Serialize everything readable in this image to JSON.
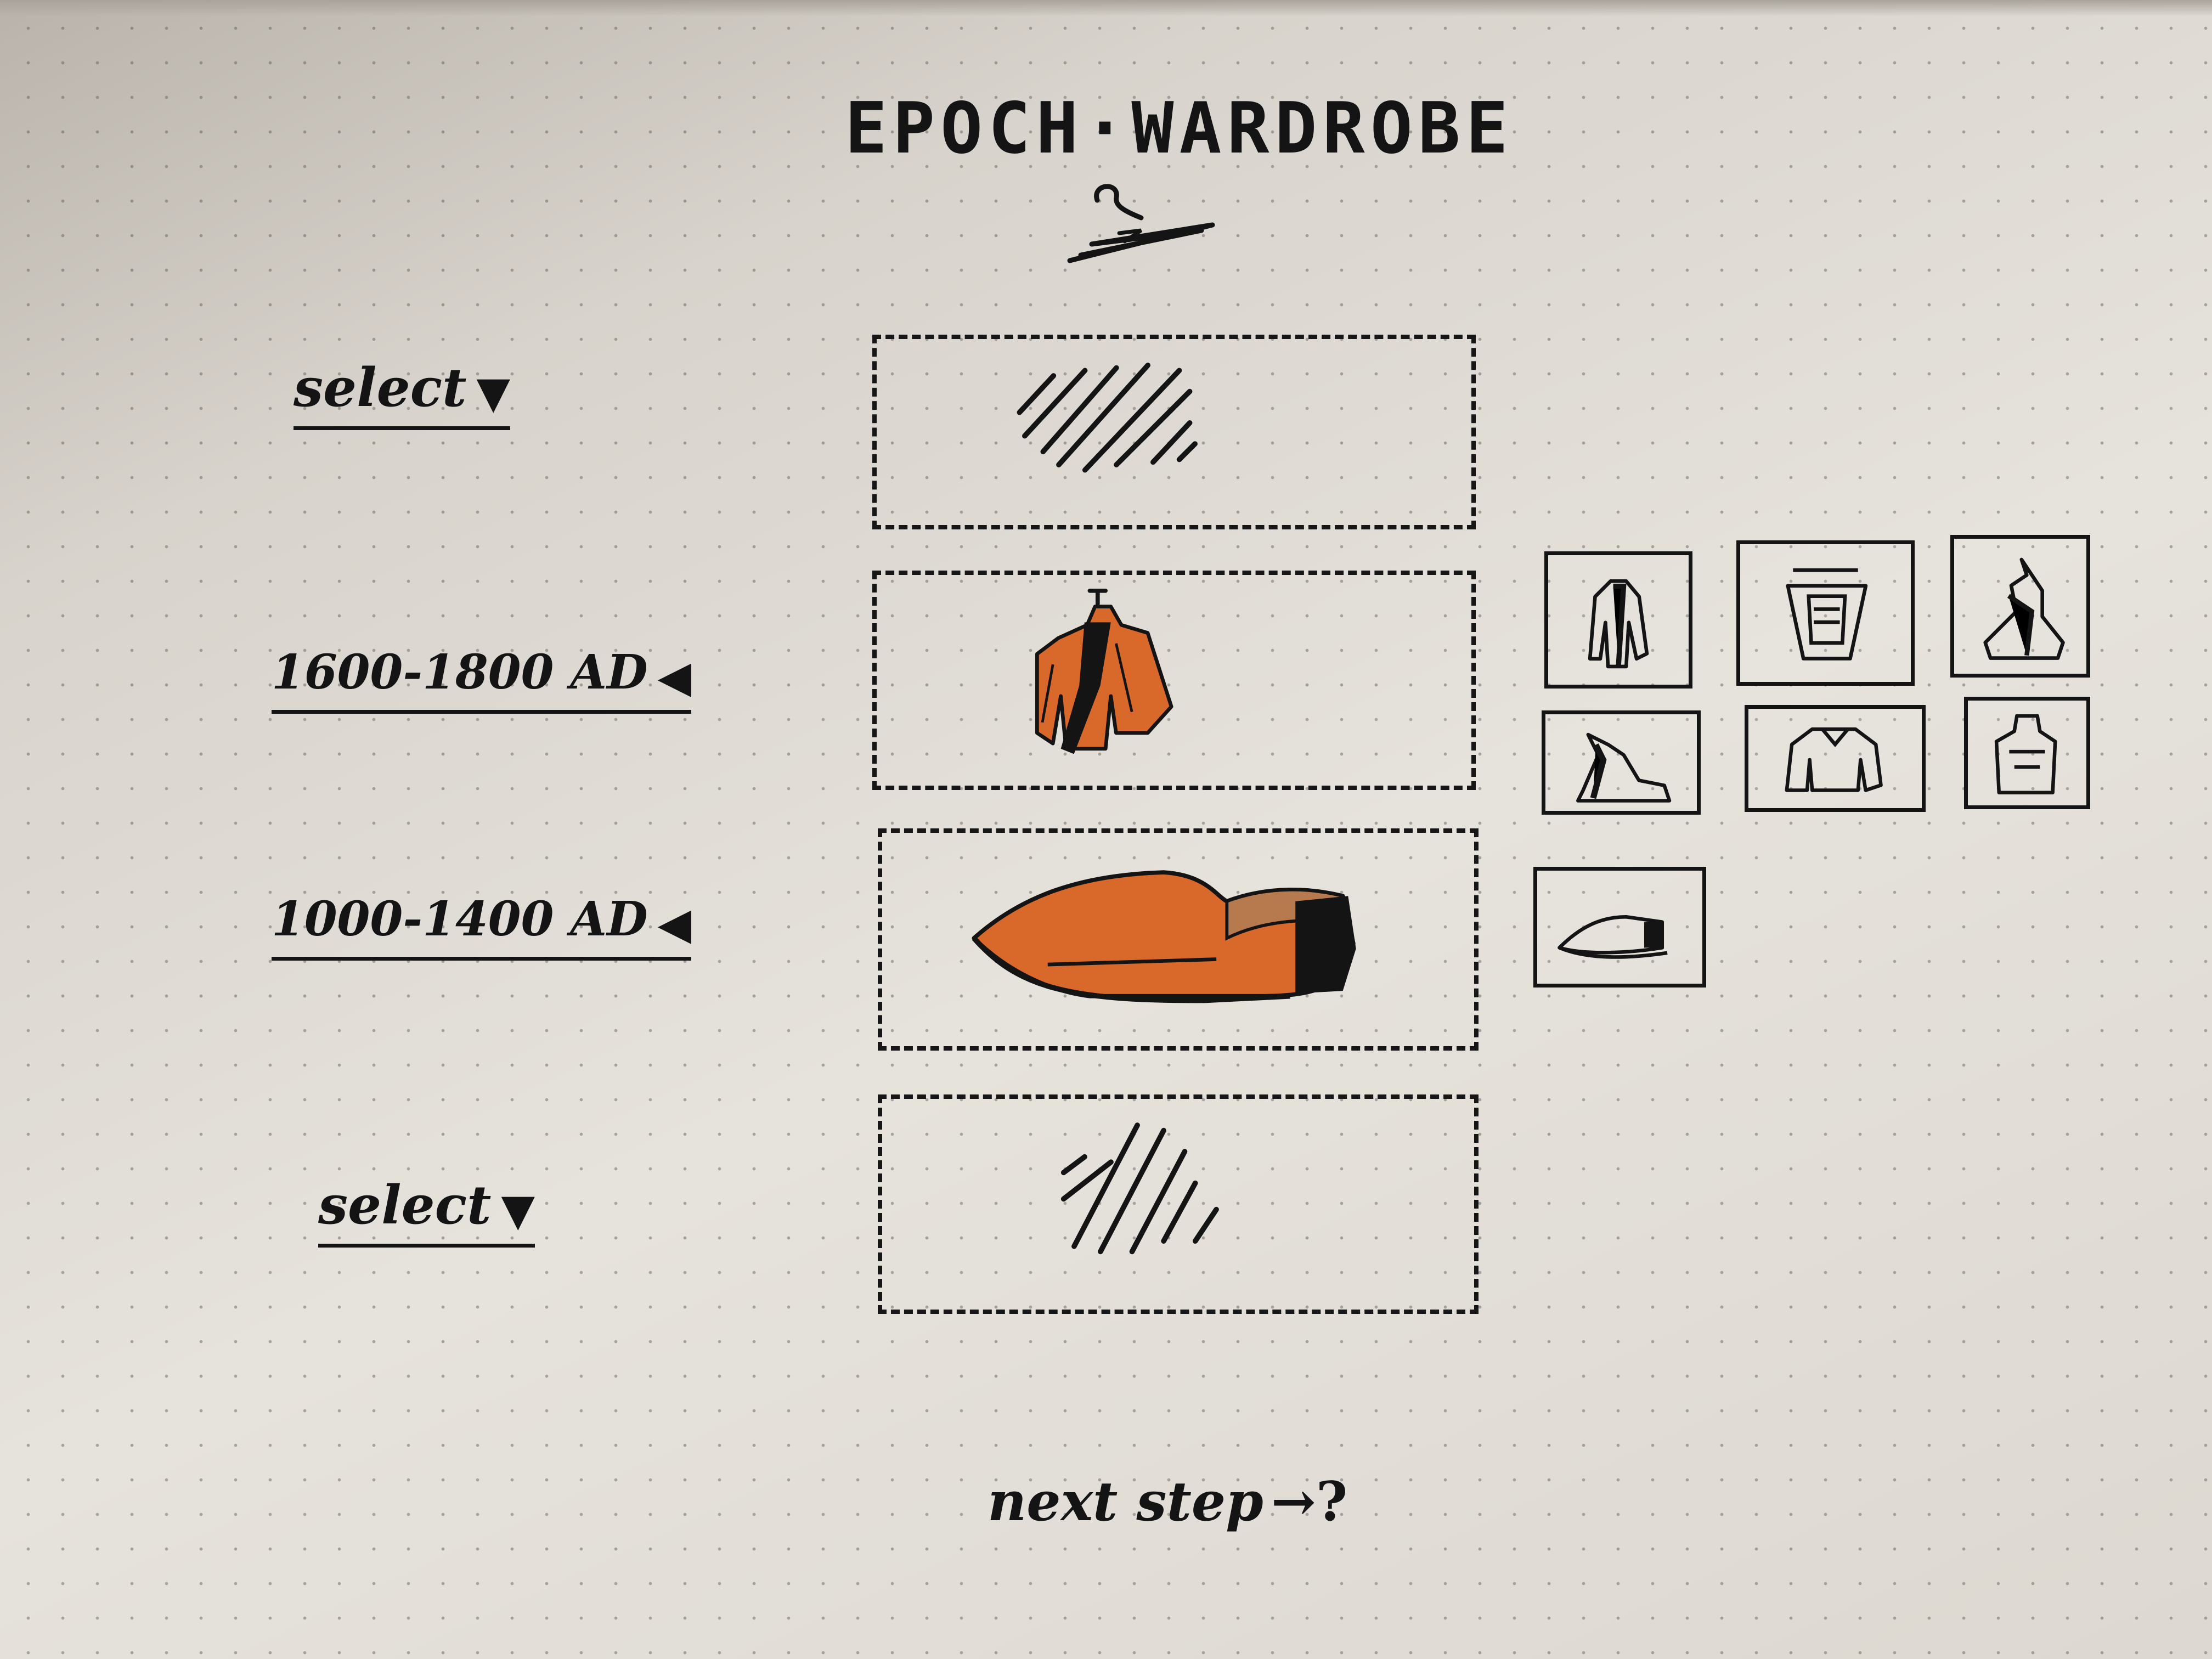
{
  "header": {
    "title": "EPOCH·WARDROBE",
    "logo_icon": "hanger-icon"
  },
  "rows": [
    {
      "label": "select",
      "caret": "▼",
      "state": "empty",
      "placeholder_icon": "hatch-placeholder-icon"
    },
    {
      "label": "1600-1800 AD",
      "caret": "◀",
      "state": "filled",
      "item_icon": "coat-icon"
    },
    {
      "label": "1000-1400 AD",
      "caret": "◀",
      "state": "filled",
      "item_icon": "shoe-icon"
    },
    {
      "label": "select",
      "caret": "▼",
      "state": "empty",
      "placeholder_icon": "hatch-placeholder-icon"
    }
  ],
  "options": {
    "row_1600_1800": [
      "coat-figure-icon",
      "chair-icon",
      "rider-figure-icon",
      "seated-figure-icon",
      "jacket-icon",
      "bust-figure-icon"
    ],
    "row_1000_1400": [
      "shoe-icon"
    ]
  },
  "footer": {
    "next_label": "next step",
    "next_arrow": "→?"
  },
  "colors": {
    "ink": "#141414",
    "paper": "#dedad4",
    "accent_orange": "#d9692b"
  }
}
